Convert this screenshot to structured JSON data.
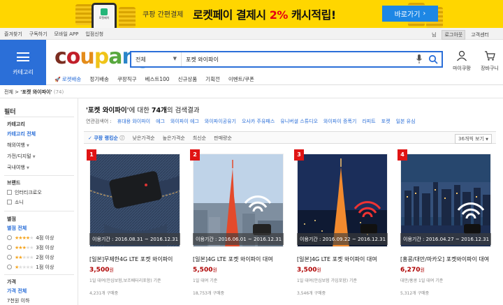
{
  "banner": {
    "phone_label": "로켓페이",
    "small_text": "쿠팡 간편결제",
    "big_text": "로켓페이 결제시",
    "percent_text": "2%",
    "cash_text": "캐시적립!",
    "button_label": "바로가기",
    "colors": {
      "bg": "#ffd600",
      "button": "#1d87e5",
      "accent": "#e60012"
    }
  },
  "topbar": {
    "left_links": [
      "즐겨찾기",
      "구독하기",
      "모바일 APP",
      "입점신청"
    ],
    "right_links": [
      "님",
      "로그아웃",
      "고객센터"
    ]
  },
  "category_button": {
    "label": "카테고리"
  },
  "logo": {
    "letters": [
      "c",
      "o",
      "u",
      "p",
      "a",
      "n",
      "g"
    ],
    "colors": [
      "#7b2d20",
      "#c11f2a",
      "#e48c1a",
      "#f0c419",
      "#58a83e",
      "#2a85c9",
      "#2a85c9"
    ]
  },
  "search": {
    "category": "전체",
    "query": "포켓 와이파이"
  },
  "user_menu": {
    "my": "마이쿠팡",
    "cart": "장바구니"
  },
  "nav": [
    "로켓배송",
    "정기배송",
    "쿠팡직구",
    "베스트100",
    "신규상품",
    "기획전",
    "이벤트/쿠폰"
  ],
  "breadcrumb": {
    "home": "전체",
    "sep": ">",
    "current": "'포켓 와이파이'",
    "count": "(74)"
  },
  "filters": {
    "title": "필터",
    "category_heading": "카테고리",
    "category_all": "카테고리 전체",
    "categories": [
      "해외여행",
      "가전/디지털",
      "국내여행"
    ],
    "brand_heading": "브랜드",
    "brands": [
      "인터티크로오",
      "소니"
    ],
    "rating_heading": "별점",
    "rating_all": "별점 전체",
    "ratings": [
      {
        "stars": 4,
        "label": "4점 이상"
      },
      {
        "stars": 3,
        "label": "3점 이상"
      },
      {
        "stars": 2,
        "label": "2점 이상"
      },
      {
        "stars": 1,
        "label": "1점 이상"
      }
    ],
    "price_heading": "가격",
    "price_all": "가격 전체",
    "price_first": "7천원 이하"
  },
  "results": {
    "query_quoted": "'포켓 와이파이'",
    "suffix_a": "에 대한",
    "count": "74개",
    "suffix_b": "의 검색결과"
  },
  "related": {
    "label": "연관검색어 :",
    "terms": [
      "휴대용 와이파이",
      "에그",
      "와이파이 에그",
      "와이파이공유기",
      "오사카 주유패스",
      "유니버셜 스튜디오",
      "와이파이 증폭기",
      "라피트",
      "포켓",
      "일본 유심"
    ]
  },
  "sort": {
    "options": [
      "쿠팡 랭킹순",
      "낮은가격순",
      "높은가격순",
      "최신순",
      "판매량순"
    ],
    "per_page": "36개씩 보기"
  },
  "products": [
    {
      "rank": "1",
      "period": "이용기간 : 2016.08.31 ~ 2016.12.31",
      "name": "[일본]무제한4G LTE 포켓 와이파이",
      "price": "3,500",
      "unit": "원",
      "desc": "1일 대여(안심보험,보조배터리포함) 기준",
      "rating": 5,
      "reviews": "4,231개 구매중"
    },
    {
      "rank": "2",
      "period": "이용기간 : 2016.06.01 ~ 2016.12.31",
      "name": "[일본]4G LTE 포켓 와이파이 대여",
      "price": "5,500",
      "unit": "원",
      "desc": "1일 대여 기준",
      "rating": 5,
      "reviews": "18,753개 구매중"
    },
    {
      "rank": "3",
      "period": "이용기간 : 2016.09.22 ~ 2016.12.31",
      "name": "[일본]4G LTE 포켓 와이파이 대여",
      "price": "3,500",
      "unit": "원",
      "desc": "1일 대여(안심보험 가입포함) 기준",
      "rating": 5,
      "reviews": "3,546개 구매중"
    },
    {
      "rank": "4",
      "period": "이용기간 : 2016.04.27 ~ 2016.12.31",
      "name": "[홍콩/대만/마카오] 포켓와이파이 대여",
      "price": "6,270",
      "unit": "원",
      "desc": "대만/홍콩 1일 대여 기준",
      "rating": 5,
      "reviews": "5,312개 구매중"
    }
  ]
}
